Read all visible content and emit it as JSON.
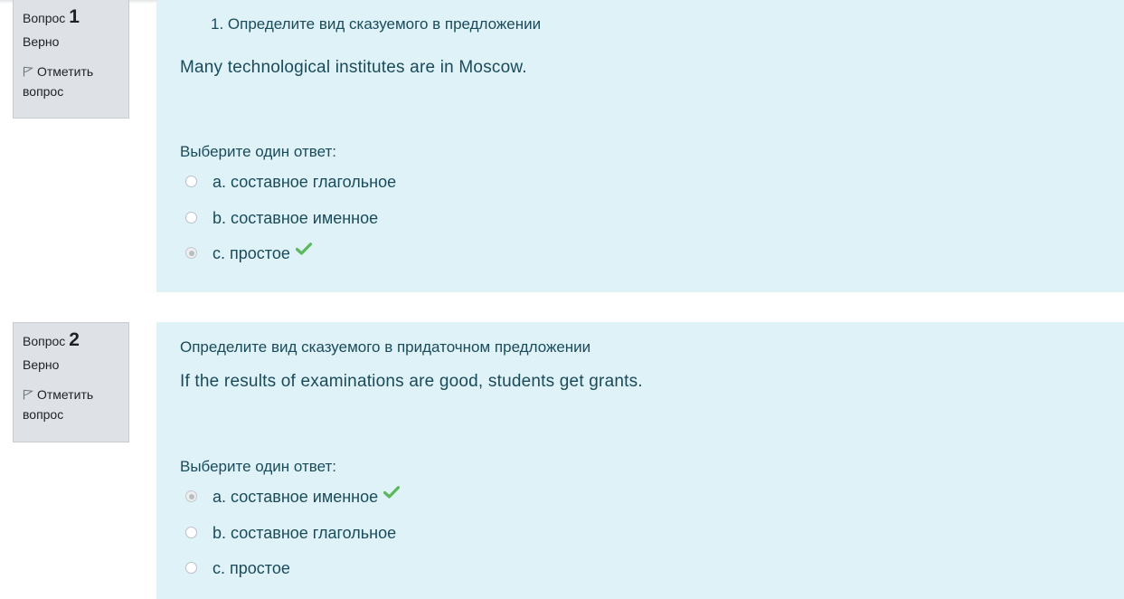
{
  "questions": [
    {
      "label": "Вопрос",
      "number": "1",
      "state": "Верно",
      "flag_label": "Отметить вопрос",
      "title": "1. Определите вид сказуемого в предложении",
      "sentence": "Many technological institutes are in Moscow.",
      "prompt": "Выберите один ответ:",
      "answers": [
        {
          "text": "a. составное глагольное",
          "checked": false,
          "correct": false
        },
        {
          "text": "b. составное именное",
          "checked": false,
          "correct": false
        },
        {
          "text": "c. простое",
          "checked": true,
          "correct": true
        }
      ]
    },
    {
      "label": "Вопрос",
      "number": "2",
      "state": "Верно",
      "flag_label": "Отметить вопрос",
      "title": "Определите вид сказуемого в придаточном предложении",
      "sentence": "If the results of examinations are good, students get grants.",
      "prompt": "Выберите один ответ:",
      "answers": [
        {
          "text": "a. составное именное",
          "checked": true,
          "correct": true
        },
        {
          "text": "b. составное глагольное",
          "checked": false,
          "correct": false
        },
        {
          "text": "c. простое",
          "checked": false,
          "correct": false
        }
      ]
    }
  ],
  "icons": {
    "flag": "flag-outline-icon",
    "correct": "checkmark-icon"
  },
  "colors": {
    "info_bg": "#dee2e6",
    "content_bg": "#def2f8",
    "text": "#1b4b5a",
    "correct": "#5cb85c"
  }
}
